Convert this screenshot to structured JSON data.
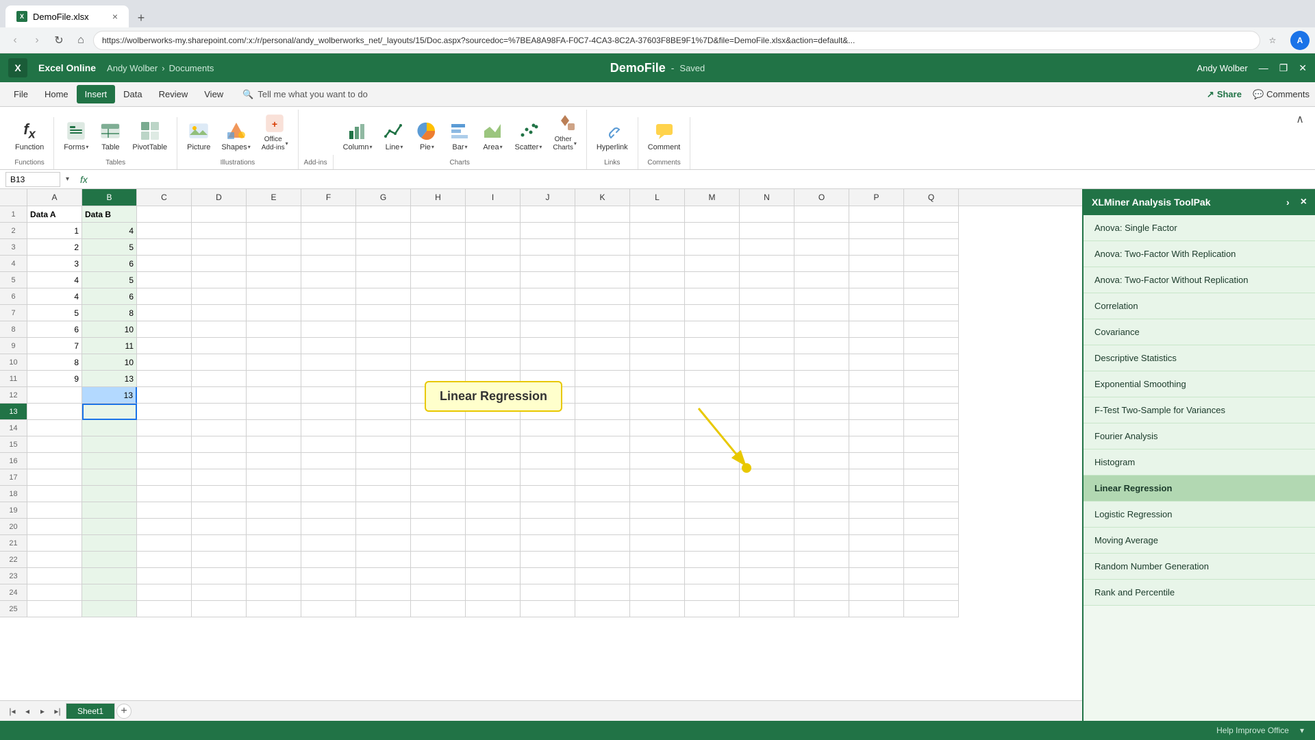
{
  "browser": {
    "tab_label": "DemoFile.xlsx",
    "favicon_text": "X",
    "url": "https://wolberworks-my.sharepoint.com/:x:/r/personal/andy_wolberworks_net/_layouts/15/Doc.aspx?sourcedoc=%7BEA8A98FA-F0C7-4CA3-8C2A-37603F8BE9F1%7D&file=DemoFile.xlsx&action=default&...",
    "new_tab_symbol": "+",
    "close_tab_symbol": "×"
  },
  "nav": {
    "back_icon": "‹",
    "forward_icon": "›",
    "refresh_icon": "↻",
    "home_icon": "⌂",
    "bookmark_icon": "☆",
    "profile_label": "A"
  },
  "titlebar": {
    "app_name": "Excel Online",
    "breadcrumb_user": "Andy Wolber",
    "breadcrumb_sep": "›",
    "breadcrumb_folder": "Documents",
    "doc_title": "DemoFile",
    "dash": "-",
    "saved_status": "Saved",
    "user_name": "Andy Wolber",
    "minimize": "—",
    "restore": "❐",
    "close": "✕"
  },
  "menu": {
    "items": [
      "File",
      "Home",
      "Insert",
      "Data",
      "Review",
      "View"
    ],
    "active_item": "Insert",
    "tell_me": "Tell me what you want to do",
    "share_label": "Share",
    "comments_label": "Comments"
  },
  "ribbon": {
    "groups": [
      {
        "name": "Functions",
        "label": "Functions",
        "items": [
          {
            "id": "function",
            "label": "Function",
            "icon": "fx"
          }
        ]
      },
      {
        "name": "Tables",
        "label": "Tables",
        "items": [
          {
            "id": "forms",
            "label": "Forms",
            "icon": "forms",
            "has_arrow": true
          },
          {
            "id": "table",
            "label": "Table",
            "icon": "table"
          },
          {
            "id": "pivottable",
            "label": "PivotTable",
            "icon": "pivot"
          }
        ]
      },
      {
        "name": "Illustrations",
        "label": "Illustrations",
        "items": [
          {
            "id": "picture",
            "label": "Picture",
            "icon": "picture"
          },
          {
            "id": "shapes",
            "label": "Shapes",
            "icon": "shapes",
            "has_arrow": true
          },
          {
            "id": "office_addins",
            "label": "Office\nAdd-ins",
            "icon": "office",
            "has_arrow": true
          }
        ]
      },
      {
        "name": "Add-ins",
        "label": "Add-ins",
        "items": []
      },
      {
        "name": "Charts",
        "label": "Charts",
        "items": [
          {
            "id": "column",
            "label": "Column",
            "icon": "column",
            "has_arrow": true
          },
          {
            "id": "line",
            "label": "Line",
            "icon": "line",
            "has_arrow": true
          },
          {
            "id": "pie",
            "label": "Pie",
            "icon": "pie",
            "has_arrow": true
          },
          {
            "id": "bar",
            "label": "Bar",
            "icon": "bar",
            "has_arrow": true
          },
          {
            "id": "area",
            "label": "Area",
            "icon": "area",
            "has_arrow": true
          },
          {
            "id": "scatter",
            "label": "Scatter",
            "icon": "scatter",
            "has_arrow": true
          },
          {
            "id": "other_charts",
            "label": "Other\nCharts",
            "icon": "other",
            "has_arrow": true
          }
        ]
      },
      {
        "name": "Links",
        "label": "Links",
        "items": [
          {
            "id": "hyperlink",
            "label": "Hyperlink",
            "icon": "hyperlink"
          }
        ]
      },
      {
        "name": "Comments",
        "label": "Comments",
        "items": [
          {
            "id": "comment",
            "label": "Comment",
            "icon": "comment"
          }
        ]
      }
    ]
  },
  "formula_bar": {
    "name_box": "B13",
    "fx_label": "fx"
  },
  "columns": [
    "A",
    "B",
    "C",
    "D",
    "E",
    "F",
    "G",
    "H",
    "I",
    "J",
    "K",
    "L",
    "M",
    "N",
    "O",
    "P",
    "Q"
  ],
  "rows": [
    {
      "num": 1,
      "a": "Data A",
      "b": "Data B"
    },
    {
      "num": 2,
      "a": "1",
      "b": "4"
    },
    {
      "num": 3,
      "a": "2",
      "b": "5"
    },
    {
      "num": 4,
      "a": "3",
      "b": "6"
    },
    {
      "num": 5,
      "a": "4",
      "b": "5"
    },
    {
      "num": 6,
      "a": "4",
      "b": "6"
    },
    {
      "num": 7,
      "a": "5",
      "b": "8"
    },
    {
      "num": 8,
      "a": "6",
      "b": "10"
    },
    {
      "num": 9,
      "a": "7",
      "b": "11"
    },
    {
      "num": 10,
      "a": "8",
      "b": "10"
    },
    {
      "num": 11,
      "a": "9",
      "b": "13"
    },
    {
      "num": 12,
      "a": "",
      "b": "13"
    },
    {
      "num": 13,
      "a": "",
      "b": ""
    },
    {
      "num": 14,
      "a": "",
      "b": ""
    },
    {
      "num": 15,
      "a": "",
      "b": ""
    },
    {
      "num": 16,
      "a": "",
      "b": ""
    },
    {
      "num": 17,
      "a": "",
      "b": ""
    },
    {
      "num": 18,
      "a": "",
      "b": ""
    },
    {
      "num": 19,
      "a": "",
      "b": ""
    },
    {
      "num": 20,
      "a": "",
      "b": ""
    },
    {
      "num": 21,
      "a": "",
      "b": ""
    },
    {
      "num": 22,
      "a": "",
      "b": ""
    },
    {
      "num": 23,
      "a": "",
      "b": ""
    },
    {
      "num": 24,
      "a": "",
      "b": ""
    },
    {
      "num": 25,
      "a": "",
      "b": ""
    }
  ],
  "sheet_tabs": [
    "Sheet1"
  ],
  "active_sheet": "Sheet1",
  "xlminer": {
    "title": "XLMiner Analysis ToolPak",
    "close_symbol": "×",
    "expand_symbol": "›",
    "items": [
      {
        "id": "anova-single",
        "label": "Anova: Single Factor"
      },
      {
        "id": "anova-two-rep",
        "label": "Anova: Two-Factor With Replication"
      },
      {
        "id": "anova-two-norep",
        "label": "Anova: Two-Factor Without Replication"
      },
      {
        "id": "correlation",
        "label": "Correlation"
      },
      {
        "id": "covariance",
        "label": "Covariance"
      },
      {
        "id": "descriptive-stats",
        "label": "Descriptive Statistics"
      },
      {
        "id": "exponential-smoothing",
        "label": "Exponential Smoothing"
      },
      {
        "id": "f-test",
        "label": "F-Test Two-Sample for Variances"
      },
      {
        "id": "fourier",
        "label": "Fourier Analysis"
      },
      {
        "id": "histogram",
        "label": "Histogram"
      },
      {
        "id": "linear-regression",
        "label": "Linear Regression"
      },
      {
        "id": "logistic-regression",
        "label": "Logistic Regression"
      },
      {
        "id": "moving-average",
        "label": "Moving Average"
      },
      {
        "id": "random-number",
        "label": "Random Number Generation"
      },
      {
        "id": "rank-percentile",
        "label": "Rank and Percentile"
      }
    ]
  },
  "callout": {
    "label": "Linear Regression"
  },
  "status_bar": {
    "help_label": "Help Improve Office"
  }
}
